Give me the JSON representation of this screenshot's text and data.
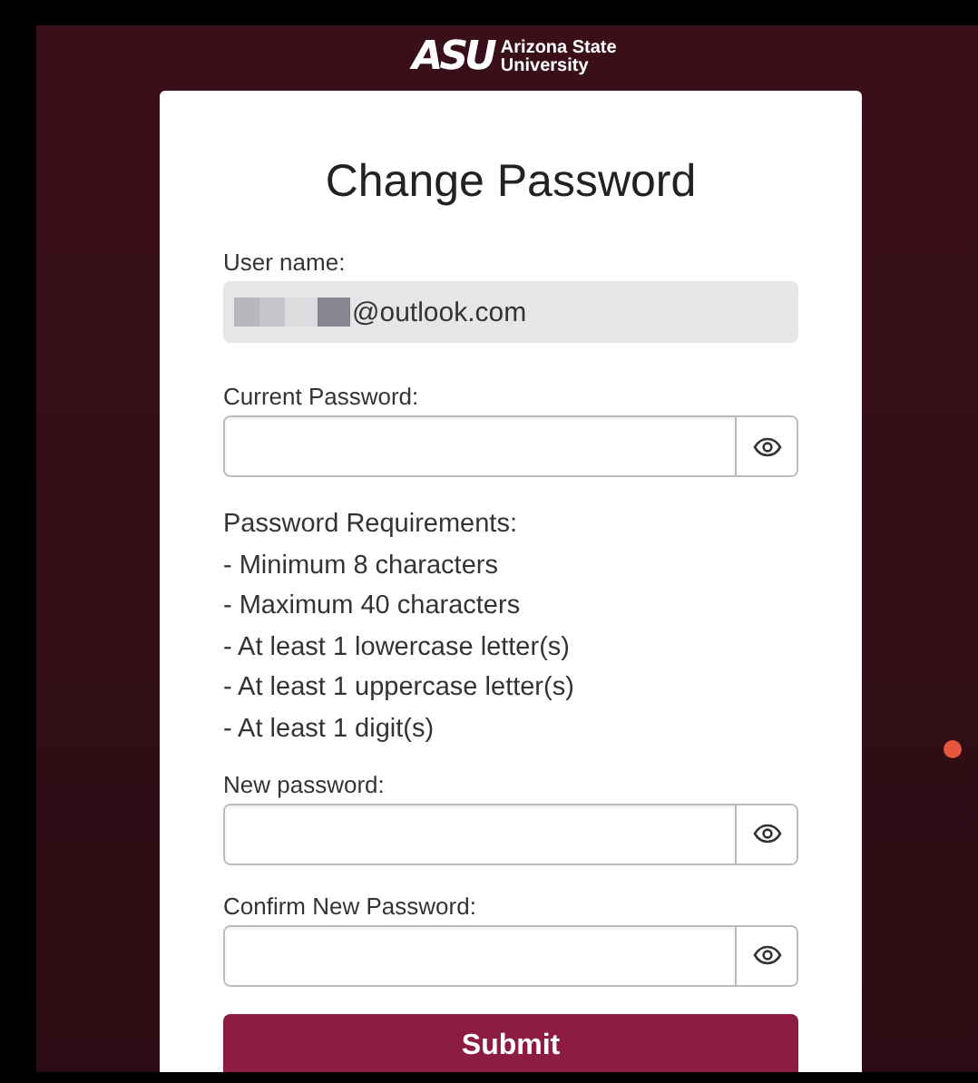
{
  "logo": {
    "mark": "ASU",
    "name_lines": [
      "Arizona State",
      "University"
    ]
  },
  "title": "Change Password",
  "username": {
    "label": "User name:",
    "value": "@outlook.com"
  },
  "current_password": {
    "label": "Current Password:"
  },
  "requirements": {
    "heading": "Password Requirements:",
    "items": [
      "- Minimum 8 characters",
      "- Maximum 40 characters",
      "- At least 1 lowercase letter(s)",
      "- At least 1 uppercase letter(s)",
      "- At least 1 digit(s)"
    ]
  },
  "new_passwords": [
    {
      "label": "New password:"
    },
    {
      "label": "Confirm New Password:"
    }
  ],
  "submit": "Submit"
}
